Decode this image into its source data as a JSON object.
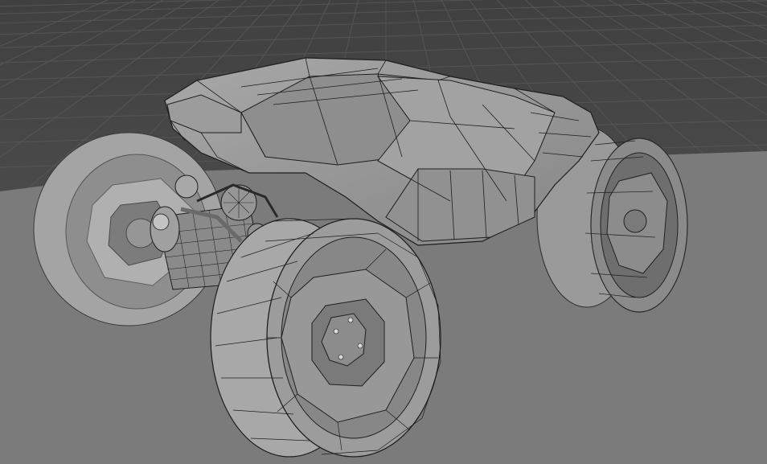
{
  "viewport": {
    "mode": "3D viewport",
    "shading": "solid",
    "overlay": "wireframe",
    "grid_floor": true
  },
  "colors": {
    "background_upper": "#454545",
    "background_lower": "#7a7a7a",
    "grid_line": "#555555",
    "mesh_fill": "#9a9a9a",
    "mesh_shadow": "#6e6e6e",
    "mesh_highlight": "#c8c8c8",
    "wire": "#1e1e1e"
  },
  "scene": {
    "objects": [
      {
        "name": "vehicle-body-icon"
      },
      {
        "name": "wheel-front-right-icon"
      },
      {
        "name": "wheel-rear-left-icon"
      },
      {
        "name": "wheel-rear-right-icon"
      },
      {
        "name": "engine-assembly-icon"
      }
    ]
  }
}
